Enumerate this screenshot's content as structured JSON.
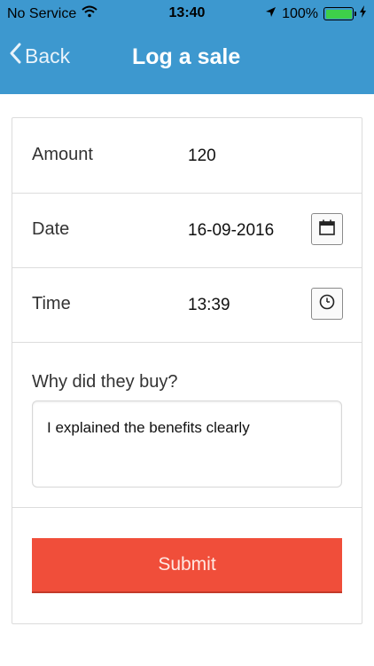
{
  "status_bar": {
    "carrier": "No Service",
    "time": "13:40",
    "battery": "100%",
    "battery_color": "#3ecf4a"
  },
  "nav": {
    "back_label": "Back",
    "title": "Log a sale",
    "bar_color": "#3d98cf"
  },
  "form": {
    "amount": {
      "label": "Amount",
      "value": "120"
    },
    "date": {
      "label": "Date",
      "value": "16-09-2016",
      "icon": "calendar-icon"
    },
    "time": {
      "label": "Time",
      "value": "13:39",
      "icon": "clock-icon"
    },
    "why": {
      "label": "Why did they buy?",
      "value": "I explained the benefits clearly"
    },
    "submit_label": "Submit",
    "submit_color": "#f04e3a"
  }
}
